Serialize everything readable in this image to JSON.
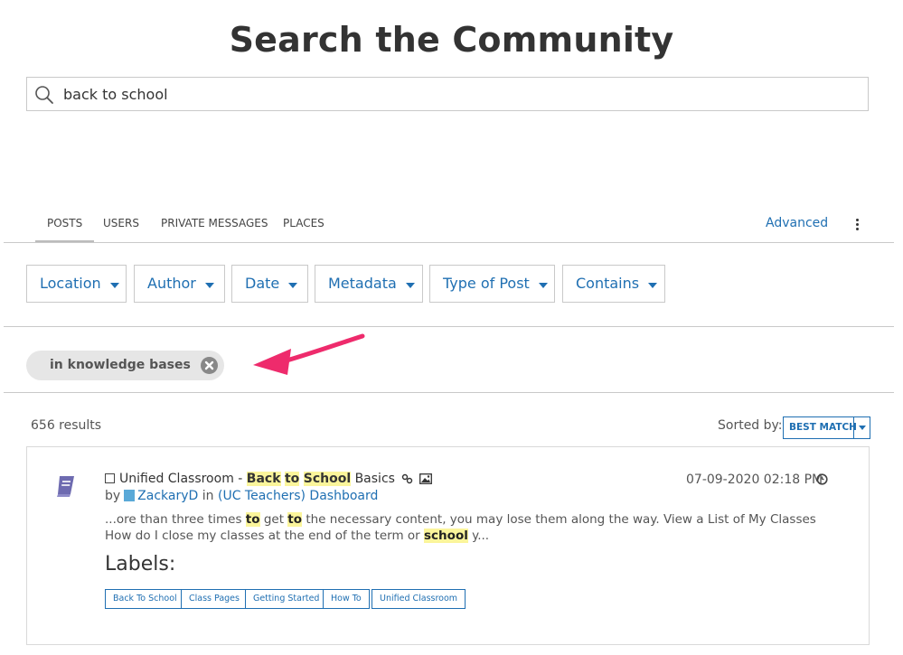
{
  "page": {
    "title": "Search the Community"
  },
  "search": {
    "value": "back to school"
  },
  "tabs": [
    {
      "label": "POSTS",
      "active": true
    },
    {
      "label": "USERS",
      "active": false
    },
    {
      "label": "PRIVATE MESSAGES",
      "active": false
    },
    {
      "label": "PLACES",
      "active": false
    }
  ],
  "advanced_label": "Advanced",
  "filters": [
    "Location",
    "Author",
    "Date",
    "Metadata",
    "Type of Post",
    "Contains"
  ],
  "active_filter_chip": {
    "label": "in knowledge bases"
  },
  "results": {
    "count_text": "656 results",
    "sorted_by_label": "Sorted by:",
    "sort_value": "BEST MATCH"
  },
  "result": {
    "title_parts": [
      "Unified Classroom - ",
      "Back",
      " ",
      "to",
      " ",
      "School",
      " Basics"
    ],
    "by_label": "by",
    "author": "ZackaryD",
    "in_label": "in",
    "location": "(UC Teachers) Dashboard",
    "date": "07-09-2020 02:18 PM",
    "snippet_parts": [
      "...ore than three times ",
      "to",
      " get ",
      "to",
      " the necessary content, you may lose them along the way.  View a List of My Classes    How do I close my classes at the end of the term or ",
      "school",
      " y..."
    ],
    "labels_heading": "Labels:",
    "labels": [
      "Back To School",
      "Class Pages",
      "Getting Started",
      "How To",
      "Unified Classroom"
    ]
  },
  "colors": {
    "link": "#1f6fb2",
    "highlight": "#fbf59b",
    "arrow": "#ee2b6c"
  }
}
